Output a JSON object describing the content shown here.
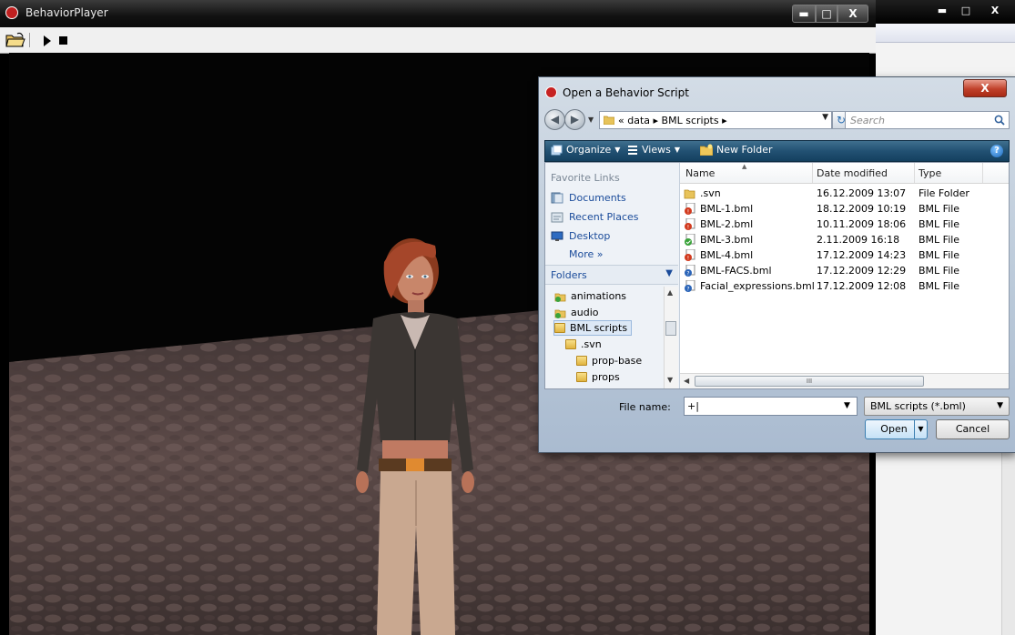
{
  "main_window": {
    "title": "BehaviorPlayer",
    "controls": {
      "minimize": "▬",
      "maximize": "□",
      "close": "X"
    }
  },
  "background_window": {
    "controls": {
      "minimize": "▬",
      "maximize": "□",
      "close": "X"
    }
  },
  "dialog": {
    "title": "Open a Behavior Script",
    "close": "X",
    "address": {
      "overflow": "«",
      "path": [
        "data",
        "BML scripts"
      ],
      "separator": "▸"
    },
    "search": {
      "placeholder": "Search"
    },
    "commands": {
      "organize": "Organize",
      "views": "Views",
      "new_folder": "New Folder",
      "help": "?"
    },
    "favorites": {
      "header": "Favorite Links",
      "items": [
        "Documents",
        "Recent Places",
        "Desktop",
        "More »"
      ]
    },
    "folders": {
      "header": "Folders",
      "tree": [
        "animations",
        "audio",
        "BML scripts",
        ".svn",
        "prop-base",
        "props"
      ]
    },
    "columns": {
      "name": "Name",
      "date": "Date modified",
      "type": "Type"
    },
    "files": [
      {
        "name": ".svn",
        "date": "16.12.2009 13:07",
        "type": "File Folder",
        "icon": "folder-icon"
      },
      {
        "name": "BML-1.bml",
        "date": "18.12.2009 10:19",
        "type": "BML File",
        "icon": "bml-error-icon"
      },
      {
        "name": "BML-2.bml",
        "date": "10.11.2009 18:06",
        "type": "BML File",
        "icon": "bml-error-icon"
      },
      {
        "name": "BML-3.bml",
        "date": "2.11.2009 16:18",
        "type": "BML File",
        "icon": "bml-ok-icon"
      },
      {
        "name": "BML-4.bml",
        "date": "17.12.2009 14:23",
        "type": "BML File",
        "icon": "bml-error-icon"
      },
      {
        "name": "BML-FACS.bml",
        "date": "17.12.2009 12:29",
        "type": "BML File",
        "icon": "bml-question-icon"
      },
      {
        "name": "Facial_expressions.bml",
        "date": "17.12.2009 12:08",
        "type": "BML File",
        "icon": "bml-question-icon"
      }
    ],
    "hscroll_thumb": "III",
    "file_name": {
      "label": "File name:",
      "value": "+|"
    },
    "file_type": {
      "value": "BML scripts (*.bml)"
    },
    "buttons": {
      "open": "Open",
      "cancel": "Cancel"
    }
  }
}
